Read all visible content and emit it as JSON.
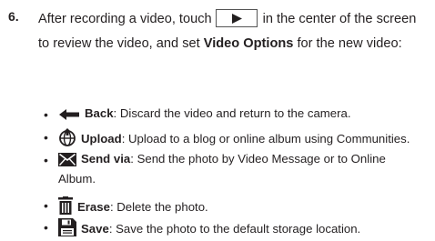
{
  "step": {
    "number": "6.",
    "text_before": "After recording a video, touch",
    "text_after": "in the center of the screen to review the video, and set",
    "bold_term": "Video Options",
    "text_end": "for the new video:"
  },
  "bullets": [
    {
      "icon": "back-arrow-icon",
      "term": "Back",
      "desc": ": Discard the video and return to the camera."
    },
    {
      "icon": "globe-upload-icon",
      "term": "Upload",
      "desc": ": Upload to a blog or online album using Communities."
    },
    {
      "icon": "envelope-send-icon",
      "term": "Send via",
      "desc": ": Send the photo by Video Message or to Online",
      "desc_cont": "Album."
    },
    {
      "icon": "trash-erase-icon",
      "term": "Erase",
      "desc": ": Delete the photo."
    },
    {
      "icon": "floppy-save-icon",
      "term": "Save",
      "desc": ": Save the photo to the default storage location."
    }
  ],
  "bullet_glyph": "•"
}
